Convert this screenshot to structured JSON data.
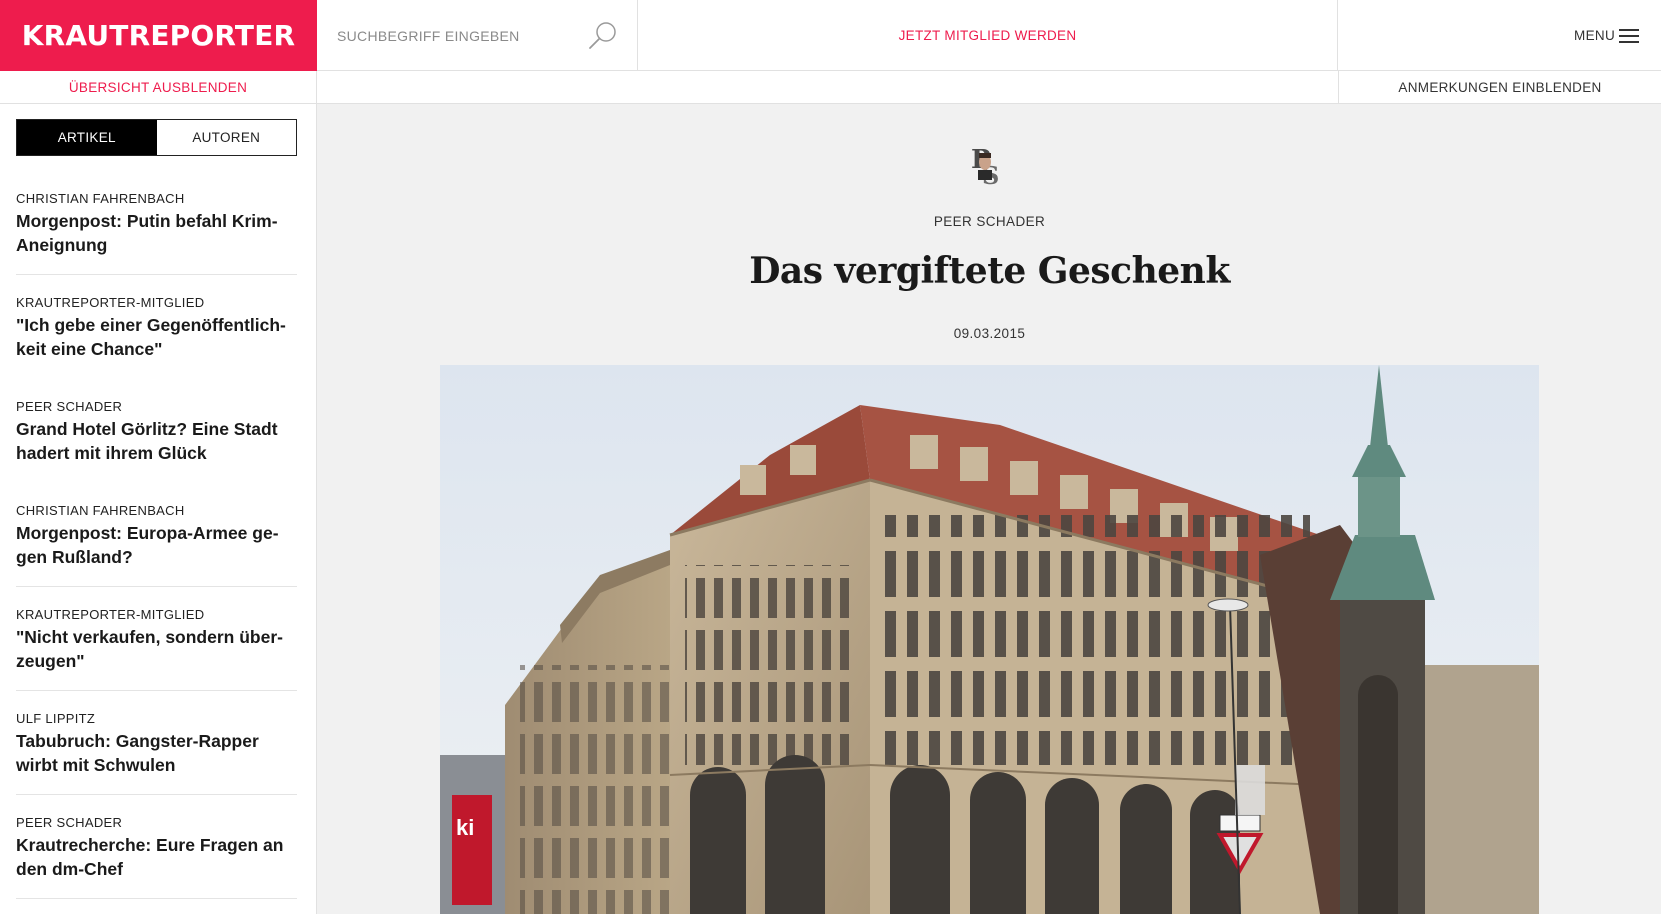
{
  "header": {
    "logo": "KRAUTREPORTER",
    "search_placeholder": "SUCHBEGRIFF EINGEBEN",
    "join_label": "JETZT MITGLIED WERDEN",
    "menu_label": "MENU"
  },
  "subbar": {
    "hide_overview": "ÜBERSICHT AUSBLENDEN",
    "show_notes": "ANMERKUNGEN EINBLENDEN"
  },
  "sidebar": {
    "tabs": [
      {
        "label": "ARTIKEL",
        "active": true
      },
      {
        "label": "AUTOREN",
        "active": false
      }
    ],
    "items": [
      {
        "author": "CHRISTIAN FAHRENBACH",
        "title": "Morgenpost: Putin befahl Krim-Aneignung"
      },
      {
        "author": "KRAUTREPORTER-MITGLIED",
        "title": "\"Ich gebe einer Gegenöffentlich­keit eine Chance\""
      },
      {
        "author": "PEER SCHADER",
        "title": "Grand Hotel Görlitz? Eine Stadt hadert mit ihrem Glück"
      },
      {
        "author": "CHRISTIAN FAHRENBACH",
        "title": "Morgenpost: Europa-Armee ge­gen Rußland?"
      },
      {
        "author": "KRAUTREPORTER-MITGLIED",
        "title": "\"Nicht verkaufen, sondern über­zeugen\""
      },
      {
        "author": "ULF LIPPITZ",
        "title": "Tabubruch: Gangster-Rapper wirbt mit Schwulen"
      },
      {
        "author": "PEER SCHADER",
        "title": "Krautrecherche: Eure Fragen an den dm-Chef"
      }
    ]
  },
  "article": {
    "author": "PEER SCHADER",
    "title": "Das vergiftete Geschenk",
    "date": "09.03.2015"
  },
  "colors": {
    "brand": "#ee1c4d",
    "text": "#222222",
    "background": "#f1f1f1"
  },
  "icons": {
    "search": "magnifier-icon",
    "menu": "hamburger-icon"
  }
}
